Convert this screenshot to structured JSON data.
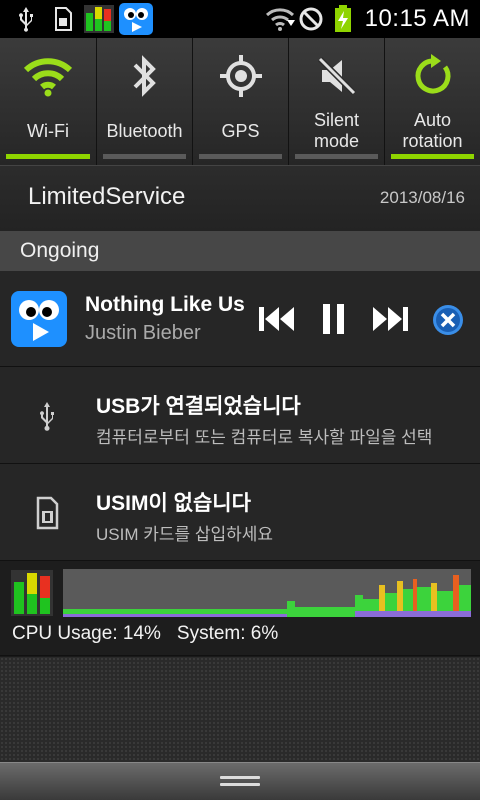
{
  "status_bar": {
    "time": "10:15 AM",
    "icons": [
      "usb-icon",
      "sim-card-icon",
      "cpu-meter-icon",
      "music-app-icon",
      "wifi-signal-icon",
      "no-signal-icon",
      "battery-charging-icon"
    ]
  },
  "quick_settings": {
    "tiles": [
      {
        "label": "Wi-Fi",
        "icon": "wifi-icon",
        "active": true
      },
      {
        "label": "Bluetooth",
        "icon": "bluetooth-icon",
        "active": false
      },
      {
        "label": "GPS",
        "icon": "gps-icon",
        "active": false
      },
      {
        "label": "Silent mode",
        "icon": "silent-mode-icon",
        "active": false
      },
      {
        "label": "Auto rotation",
        "icon": "auto-rotation-icon",
        "active": true
      }
    ],
    "active_color": "#8fd400"
  },
  "carrier": {
    "name": "LimitedService",
    "date": "2013/08/16"
  },
  "ongoing": {
    "label": "Ongoing"
  },
  "music": {
    "title": "Nothing Like Us (",
    "artist": "Justin Bieber",
    "controls": [
      "previous-icon",
      "pause-icon",
      "next-icon",
      "close-icon"
    ]
  },
  "usb_notification": {
    "title": "USB가 연결되었습니다",
    "subtitle": "컴퓨터로부터 또는 컴퓨터로 복사할 파일을 선택",
    "icon": "usb-icon"
  },
  "usim_notification": {
    "title": "USIM이 없습니다",
    "subtitle": "USIM 카드를 삽입하세요",
    "icon": "sim-card-icon"
  },
  "cpu_monitor": {
    "usage_text": "CPU Usage: 14%",
    "system_text": "System: 6%",
    "usage_percent": 14,
    "system_percent": 6
  }
}
